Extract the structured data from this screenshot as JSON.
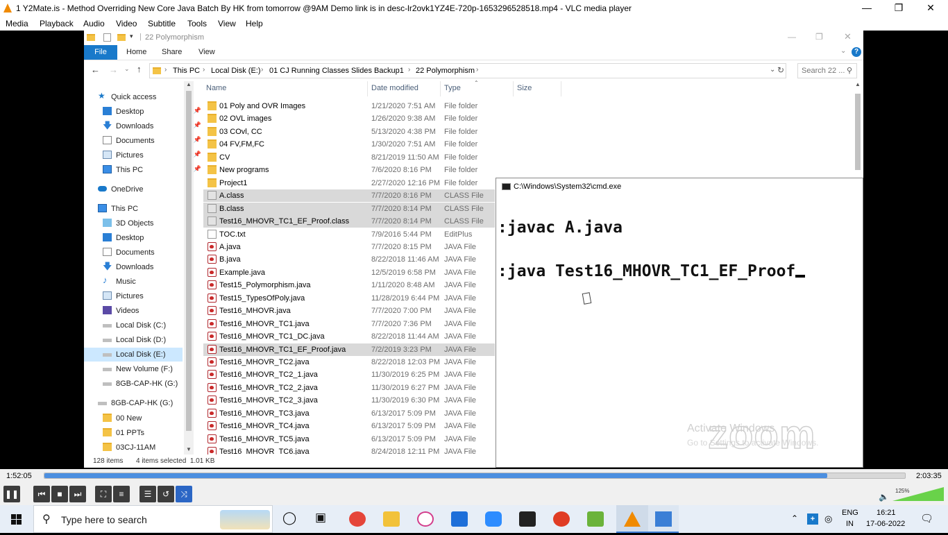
{
  "vlc": {
    "title": "1 Y2Mate.is - Method Overriding  New Core Java Batch By HK from tomorrow @9AM  Demo link is in desc-lr2ovk1YZ4E-720p-1653296528518.mp4 - VLC media player",
    "menu": [
      "Media",
      "Playback",
      "Audio",
      "Video",
      "Subtitle",
      "Tools",
      "View",
      "Help"
    ],
    "time_elapsed": "1:52:05",
    "time_total": "2:03:35",
    "progress": 0.91,
    "volume_pct": "125%"
  },
  "explorer": {
    "title": "22 Polymorphism",
    "ribbon": {
      "file": "File",
      "tabs": [
        "Home",
        "Share",
        "View"
      ]
    },
    "breadcrumb": [
      "This PC",
      "Local Disk (E:)",
      "01 CJ Running Classes Slides",
      "Backup1",
      "22 Polymorphism"
    ],
    "search_placeholder": "Search 22 ...",
    "columns": {
      "name": "Name",
      "date": "Date modified",
      "type": "Type",
      "size": "Size"
    },
    "nav": [
      {
        "label": "Quick access"
      },
      {
        "label": "Desktop"
      },
      {
        "label": "Downloads"
      },
      {
        "label": "Documents"
      },
      {
        "label": "Pictures"
      },
      {
        "label": "This PC"
      },
      {
        "label": "OneDrive"
      },
      {
        "label": "This PC"
      },
      {
        "label": "3D Objects"
      },
      {
        "label": "Desktop"
      },
      {
        "label": "Documents"
      },
      {
        "label": "Downloads"
      },
      {
        "label": "Music"
      },
      {
        "label": "Pictures"
      },
      {
        "label": "Videos"
      },
      {
        "label": "Local Disk (C:)"
      },
      {
        "label": "Local Disk (D:)"
      },
      {
        "label": "Local Disk (E:)"
      },
      {
        "label": "New Volume (F:)"
      },
      {
        "label": "8GB-CAP-HK (G:)"
      },
      {
        "label": "8GB-CAP-HK (G:)"
      },
      {
        "label": "00 New"
      },
      {
        "label": "01 PPTs"
      },
      {
        "label": "03CJ-11AM"
      }
    ],
    "files": [
      {
        "name": "01 Poly and OVR Images",
        "date": "1/21/2020 7:51 AM",
        "type": "File folder",
        "icon": "folder"
      },
      {
        "name": "02 OVL images",
        "date": "1/26/2020 9:38 AM",
        "type": "File folder",
        "icon": "folder"
      },
      {
        "name": "03 COvl, CC",
        "date": "5/13/2020 4:38 PM",
        "type": "File folder",
        "icon": "folder"
      },
      {
        "name": "04 FV,FM,FC",
        "date": "1/30/2020 7:51 AM",
        "type": "File folder",
        "icon": "folder"
      },
      {
        "name": "CV",
        "date": "8/21/2019 11:50 AM",
        "type": "File folder",
        "icon": "folder"
      },
      {
        "name": "New programs",
        "date": "7/6/2020 8:16 PM",
        "type": "File folder",
        "icon": "folder"
      },
      {
        "name": "Project1",
        "date": "2/27/2020 12:16 PM",
        "type": "File folder",
        "icon": "folder"
      },
      {
        "name": "A.class",
        "date": "7/7/2020 8:16 PM",
        "type": "CLASS File",
        "icon": "class",
        "selected": true
      },
      {
        "name": "B.class",
        "date": "7/7/2020 8:14 PM",
        "type": "CLASS File",
        "icon": "class",
        "selected": true
      },
      {
        "name": "Test16_MHOVR_TC1_EF_Proof.class",
        "date": "7/7/2020 8:14 PM",
        "type": "CLASS File",
        "icon": "class",
        "selected": true
      },
      {
        "name": "TOC.txt",
        "date": "7/9/2016 5:44 PM",
        "type": "EditPlus",
        "icon": "txt"
      },
      {
        "name": "A.java",
        "date": "7/7/2020 8:15 PM",
        "type": "JAVA File",
        "icon": "java"
      },
      {
        "name": "B.java",
        "date": "8/22/2018 11:46 AM",
        "type": "JAVA File",
        "icon": "java"
      },
      {
        "name": "Example.java",
        "date": "12/5/2019 6:58 PM",
        "type": "JAVA File",
        "icon": "java"
      },
      {
        "name": "Test15_Polymorphism.java",
        "date": "1/11/2020 8:48 AM",
        "type": "JAVA File",
        "icon": "java"
      },
      {
        "name": "Test15_TypesOfPoly.java",
        "date": "11/28/2019 6:44 PM",
        "type": "JAVA File",
        "icon": "java"
      },
      {
        "name": "Test16_MHOVR.java",
        "date": "7/7/2020 7:00 PM",
        "type": "JAVA File",
        "icon": "java"
      },
      {
        "name": "Test16_MHOVR_TC1.java",
        "date": "7/7/2020 7:36 PM",
        "type": "JAVA File",
        "icon": "java"
      },
      {
        "name": "Test16_MHOVR_TC1_DC.java",
        "date": "8/22/2018 11:44 AM",
        "type": "JAVA File",
        "icon": "java"
      },
      {
        "name": "Test16_MHOVR_TC1_EF_Proof.java",
        "date": "7/2/2019 3:23 PM",
        "type": "JAVA File",
        "icon": "java",
        "selected": true
      },
      {
        "name": "Test16_MHOVR_TC2.java",
        "date": "8/22/2018 12:03 PM",
        "type": "JAVA File",
        "icon": "java"
      },
      {
        "name": "Test16_MHOVR_TC2_1.java",
        "date": "11/30/2019 6:25 PM",
        "type": "JAVA File",
        "icon": "java"
      },
      {
        "name": "Test16_MHOVR_TC2_2.java",
        "date": "11/30/2019 6:27 PM",
        "type": "JAVA File",
        "icon": "java"
      },
      {
        "name": "Test16_MHOVR_TC2_3.java",
        "date": "11/30/2019 6:30 PM",
        "type": "JAVA File",
        "icon": "java"
      },
      {
        "name": "Test16_MHOVR_TC3.java",
        "date": "6/13/2017 5:09 PM",
        "type": "JAVA File",
        "icon": "java"
      },
      {
        "name": "Test16_MHOVR_TC4.java",
        "date": "6/13/2017 5:09 PM",
        "type": "JAVA File",
        "icon": "java"
      },
      {
        "name": "Test16_MHOVR_TC5.java",
        "date": "6/13/2017 5:09 PM",
        "type": "JAVA File",
        "icon": "java"
      },
      {
        "name": "Test16_MHOVR_TC6.java",
        "date": "8/24/2018 12:11 PM",
        "type": "JAVA File",
        "icon": "java"
      }
    ],
    "status": {
      "items": "128 items",
      "selected": "4 items selected  1.01 KB"
    }
  },
  "cmd": {
    "title": "C:\\Windows\\System32\\cmd.exe",
    "line1": ":javac A.java",
    "line2": ":java Test16_MHOVR_TC1_EF_Proof",
    "watermark_logo": "zoom",
    "watermark_line1": "Activate Windows",
    "watermark_line2": "Go to Settings to activate Windows."
  },
  "taskbar": {
    "search_text": "Type here to search",
    "lang": "ENG",
    "region": "IN",
    "time": "16:21",
    "date": "17-06-2022"
  }
}
